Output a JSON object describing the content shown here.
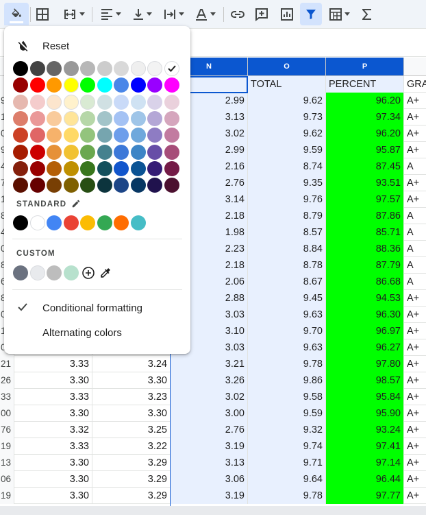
{
  "toolbar": {
    "items": [
      "fill-color-icon",
      "borders-icon",
      "merge-cells-icon",
      "horizontal-align-icon",
      "vertical-align-icon",
      "text-rotation-icon",
      "text-color-icon",
      "insert-link-icon",
      "insert-comment-icon",
      "insert-chart-icon",
      "filter-icon",
      "filter-views-icon",
      "functions-icon"
    ]
  },
  "columns": [
    {
      "id": "N",
      "label": "N"
    },
    {
      "id": "O",
      "label": "O"
    },
    {
      "id": "P",
      "label": "P"
    }
  ],
  "header_row": {
    "n": "",
    "o": "TOTAL",
    "p": "PERCENT",
    "q": "GRA"
  },
  "rows": [
    {
      "rh": "9",
      "k": "",
      "l": "",
      "m": "",
      "n": "2.99",
      "o": "9.62",
      "p": "96.20",
      "q": "A+"
    },
    {
      "rh": "1",
      "k": "",
      "l": "",
      "m": "",
      "n": "3.13",
      "o": "9.73",
      "p": "97.34",
      "q": "A+"
    },
    {
      "rh": "0",
      "k": "",
      "l": "",
      "m": "",
      "n": "3.02",
      "o": "9.62",
      "p": "96.20",
      "q": "A+"
    },
    {
      "rh": "9",
      "k": "",
      "l": "",
      "m": "",
      "n": "2.99",
      "o": "9.59",
      "p": "95.87",
      "q": "A+"
    },
    {
      "rh": "4",
      "k": "",
      "l": "",
      "m": "",
      "n": "2.16",
      "o": "8.74",
      "p": "87.45",
      "q": "A"
    },
    {
      "rh": "7",
      "k": "",
      "l": "",
      "m": "",
      "n": "2.76",
      "o": "9.35",
      "p": "93.51",
      "q": "A+"
    },
    {
      "rh": "1",
      "k": "",
      "l": "",
      "m": "",
      "n": "3.14",
      "o": "9.76",
      "p": "97.57",
      "q": "A+"
    },
    {
      "rh": "8",
      "k": "",
      "l": "",
      "m": "",
      "n": "2.18",
      "o": "8.79",
      "p": "87.86",
      "q": "A"
    },
    {
      "rh": "4",
      "k": "",
      "l": "",
      "m": "",
      "n": "1.98",
      "o": "8.57",
      "p": "85.71",
      "q": "A"
    },
    {
      "rh": "0",
      "k": "",
      "l": "",
      "m": "",
      "n": "2.23",
      "o": "8.84",
      "p": "88.36",
      "q": "A"
    },
    {
      "rh": "8",
      "k": "",
      "l": "",
      "m": "",
      "n": "2.18",
      "o": "8.78",
      "p": "87.79",
      "q": "A"
    },
    {
      "rh": "6",
      "k": "",
      "l": "",
      "m": "",
      "n": "2.06",
      "o": "8.67",
      "p": "86.68",
      "q": "A"
    },
    {
      "rh": "8",
      "k": "",
      "l": "",
      "m": "",
      "n": "2.88",
      "o": "9.45",
      "p": "94.53",
      "q": "A+"
    },
    {
      "rh": "0",
      "k": "",
      "l": "",
      "m": "",
      "n": "3.03",
      "o": "9.63",
      "p": "96.30",
      "q": "A+"
    },
    {
      "rh": "1",
      "k": "",
      "l": "",
      "m": "",
      "n": "3.10",
      "o": "9.70",
      "p": "96.97",
      "q": "A+"
    },
    {
      "rh": "0",
      "k": "",
      "l": "",
      "m": "",
      "n": "3.03",
      "o": "9.63",
      "p": "96.27",
      "q": "A+"
    },
    {
      "rh": "21",
      "k": "3.33",
      "l": "3.24",
      "n": "3.21",
      "o": "9.78",
      "p": "97.80",
      "q": "A+"
    },
    {
      "rh": "26",
      "k": "3.30",
      "l": "3.30",
      "n": "3.26",
      "o": "9.86",
      "p": "98.57",
      "q": "A+"
    },
    {
      "rh": "33",
      "k": "3.33",
      "l": "3.23",
      "n": "3.02",
      "o": "9.58",
      "p": "95.84",
      "q": "A+"
    },
    {
      "rh": "00",
      "k": "3.30",
      "l": "3.30",
      "n": "3.00",
      "o": "9.59",
      "p": "95.90",
      "q": "A+"
    },
    {
      "rh": "76",
      "k": "3.32",
      "l": "3.25",
      "n": "2.76",
      "o": "9.32",
      "p": "93.24",
      "q": "A+"
    },
    {
      "rh": "19",
      "k": "3.33",
      "l": "3.22",
      "n": "3.19",
      "o": "9.74",
      "p": "97.41",
      "q": "A+"
    },
    {
      "rh": "13",
      "k": "3.30",
      "l": "3.29",
      "n": "3.13",
      "o": "9.71",
      "p": "97.14",
      "q": "A+"
    },
    {
      "rh": "06",
      "k": "3.30",
      "l": "3.29",
      "n": "3.06",
      "o": "9.64",
      "p": "96.44",
      "q": "A+"
    },
    {
      "rh": "19",
      "k": "3.30",
      "l": "3.29",
      "n": "3.19",
      "o": "9.78",
      "p": "97.77",
      "q": "A+"
    }
  ],
  "color_menu": {
    "reset_label": "Reset",
    "palette": [
      [
        "#000000",
        "#434343",
        "#666666",
        "#999999",
        "#b7b7b7",
        "#cccccc",
        "#d9d9d9",
        "#efefef",
        "#f3f3f3",
        "#ffffff"
      ],
      [
        "#980000",
        "#ff0000",
        "#ff9900",
        "#ffff00",
        "#00ff00",
        "#00ffff",
        "#4a86e8",
        "#0000ff",
        "#9900ff",
        "#ff00ff"
      ],
      [
        "#e6b8af",
        "#f4cccc",
        "#fce5cd",
        "#fff2cc",
        "#d9ead3",
        "#d0e0e3",
        "#c9daf8",
        "#cfe2f3",
        "#d9d2e9",
        "#ead1dc"
      ],
      [
        "#dd7e6b",
        "#ea9999",
        "#f9cb9c",
        "#ffe599",
        "#b6d7a8",
        "#a2c4c9",
        "#a4c2f4",
        "#9fc5e8",
        "#b4a7d6",
        "#d5a6bd"
      ],
      [
        "#cc4125",
        "#e06666",
        "#f6b26b",
        "#ffd966",
        "#93c47d",
        "#76a5af",
        "#6d9eeb",
        "#6fa8dc",
        "#8e7cc3",
        "#c27ba0"
      ],
      [
        "#a61c00",
        "#cc0000",
        "#e69138",
        "#f1c232",
        "#6aa84f",
        "#45818e",
        "#3c78d8",
        "#3d85c6",
        "#674ea7",
        "#a64d79"
      ],
      [
        "#85200c",
        "#990000",
        "#b45f06",
        "#bf9000",
        "#38761d",
        "#134f5c",
        "#1155cc",
        "#0b5394",
        "#351c75",
        "#741b47"
      ],
      [
        "#5b0f00",
        "#660000",
        "#783f04",
        "#7f6000",
        "#274e13",
        "#0c343d",
        "#1c4587",
        "#073763",
        "#20124d",
        "#4c1130"
      ]
    ],
    "standard_label": "STANDARD",
    "standard": [
      "#000000",
      "#ffffff",
      "#4285f4",
      "#ea4335",
      "#fbbc04",
      "#34a853",
      "#ff6d01",
      "#46bdc6"
    ],
    "custom_label": "CUSTOM",
    "custom": [
      "#6b7280",
      "#e8eaed",
      "#bdbdbd",
      "#b7e1cd"
    ],
    "conditional_formatting": "Conditional formatting",
    "alternating_colors": "Alternating colors"
  }
}
